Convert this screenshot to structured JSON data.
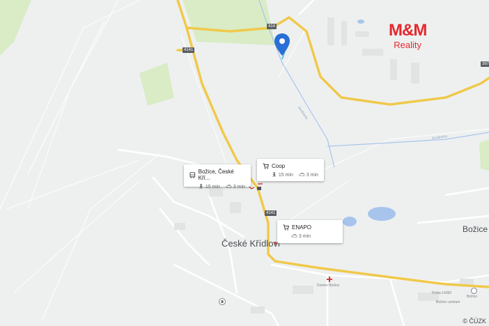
{
  "map": {
    "town_main": "České Křídlovi",
    "town_east": "Božice",
    "small_labels": {
      "hospital": "Domov Božice",
      "post": "Pošta 14359",
      "school": "Božice",
      "museum": "Božice centrum"
    },
    "stream_labels": [
      "Jevišovka",
      "Jevišovka"
    ],
    "road_numbers": [
      "414",
      "4141",
      "4141",
      "397"
    ],
    "copyright": "© ČÚZK"
  },
  "logo": {
    "main": "M&M",
    "sub": "Reality",
    "color": "#e5282e"
  },
  "pois": [
    {
      "title": "Božice, České Kří...",
      "icon": "bus-icon",
      "walk": "15 min",
      "drive": "3 min"
    },
    {
      "title": "Coop",
      "icon": "cart-icon",
      "walk": "15 min",
      "drive": "3 min"
    },
    {
      "title": "ENAPO",
      "icon": "cart-icon",
      "drive": "3 min"
    }
  ],
  "colors": {
    "marker": "#2a6fd6",
    "road": "#f0c94a",
    "water": "#a7c5ec",
    "field": "#d9ecc6"
  }
}
